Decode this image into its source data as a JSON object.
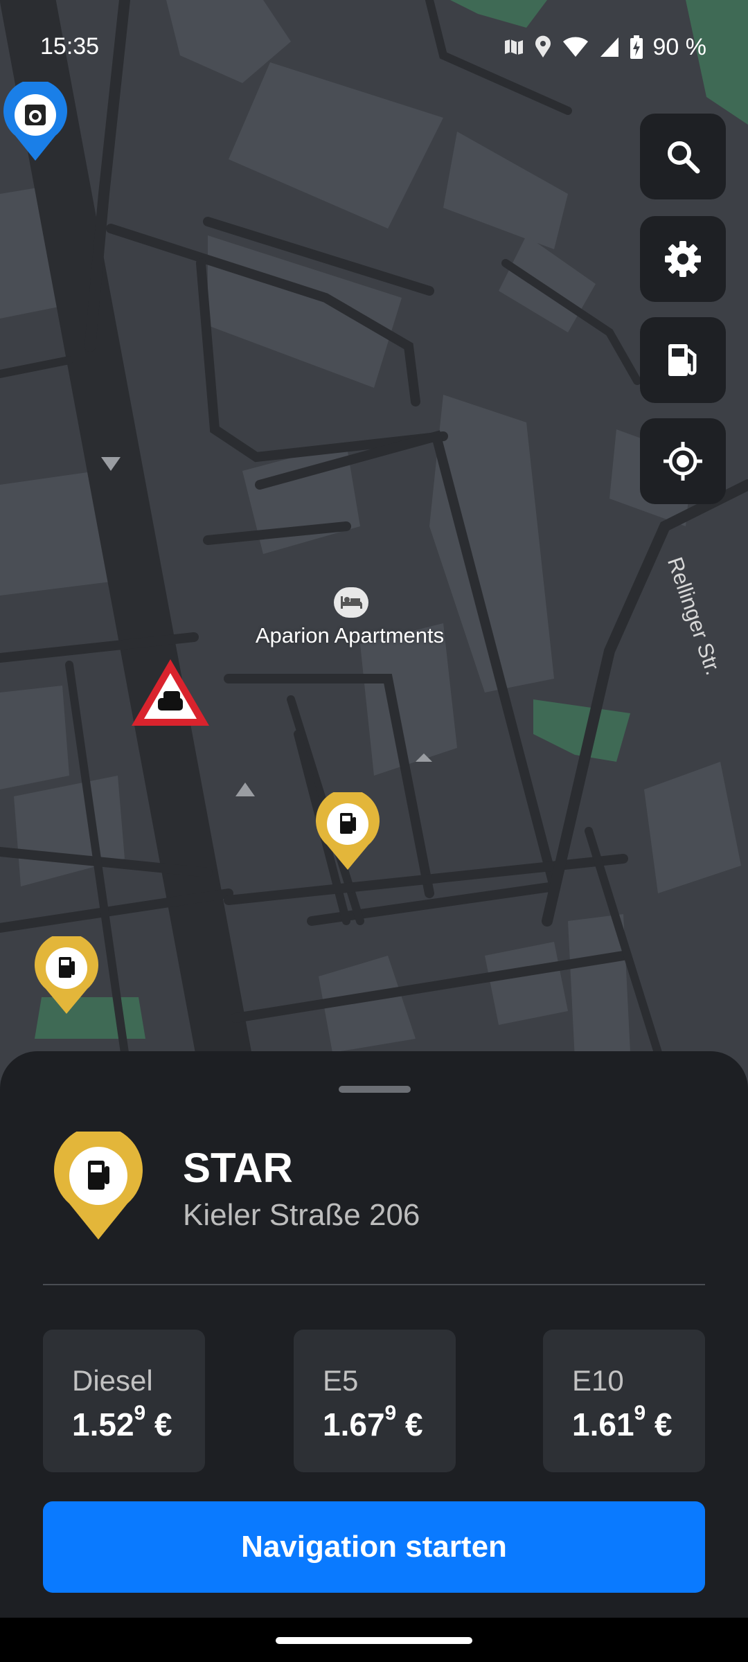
{
  "status_bar": {
    "time": "15:35",
    "battery": "90 %",
    "icons": [
      "map-icon",
      "location-icon",
      "wifi-icon",
      "signal-icon",
      "battery-icon"
    ]
  },
  "map": {
    "poi_label": "Aparion Apartments",
    "street_label": "Rellinger Str.",
    "controls": [
      "search-icon",
      "settings-gear-icon",
      "fuel-station-icon",
      "my-location-icon"
    ],
    "markers": [
      "speed-camera-pin",
      "traffic-jam-warning",
      "fuel-pin",
      "fuel-pin"
    ]
  },
  "sheet": {
    "station_name": "STAR",
    "address": "Kieler Straße 206",
    "prices": [
      {
        "label": "Diesel",
        "main": "1.52",
        "sup": "9",
        "unit": "€"
      },
      {
        "label": "E5",
        "main": "1.67",
        "sup": "9",
        "unit": "€"
      },
      {
        "label": "E10",
        "main": "1.61",
        "sup": "9",
        "unit": "€"
      }
    ],
    "nav_button": "Navigation starten"
  },
  "colors": {
    "accent": "#0a7aff",
    "fuel_pin": "#e3b63a",
    "camera_pin": "#1a7fe8",
    "warning": "#d9232d"
  }
}
